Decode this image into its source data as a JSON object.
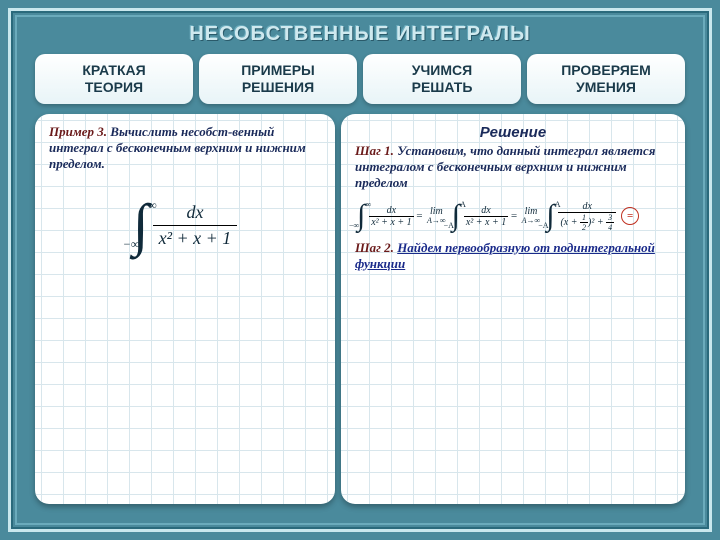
{
  "title": "НЕСОБСТВЕННЫЕ ИНТЕГРАЛЫ",
  "tabs": [
    {
      "line1": "КРАТКАЯ",
      "line2": "ТЕОРИЯ"
    },
    {
      "line1": "ПРИМЕРЫ",
      "line2": "РЕШЕНИЯ"
    },
    {
      "line1": "УЧИМСЯ",
      "line2": "РЕШАТЬ"
    },
    {
      "line1": "ПРОВЕРЯЕМ",
      "line2": "УМЕНИЯ"
    }
  ],
  "left": {
    "example_label": "Пример 3.",
    "task": "Вычислить несобст-венный интеграл с бесконечным верхним и нижним пределом.",
    "integral": {
      "upper": "∞",
      "lower": "−∞",
      "num": "dx",
      "den": "x² + x + 1"
    }
  },
  "right": {
    "solution_title": "Решение",
    "step1_label": "Шаг 1.",
    "step1_text": "Установим, что данный интеграл является интегралом с бесконечным верхним и нижним пределом",
    "step2_label": "Шаг 2.",
    "step2_link": "Найдем первообразную от подинтегральной функции",
    "eq": {
      "t1": {
        "up": "∞",
        "lo": "−∞",
        "num": "dx",
        "den": "x² + x + 1"
      },
      "eq1": "=",
      "lim1": {
        "top": "lim",
        "under": "A→∞"
      },
      "t2": {
        "up": "A",
        "lo": "−A",
        "num": "dx",
        "den": "x² + x + 1"
      },
      "eq2": "=",
      "lim2": {
        "top": "lim",
        "under": "A→∞"
      },
      "t3": {
        "up": "A",
        "lo": "−A",
        "num": "dx",
        "den_open": "(x + ",
        "den_half_n": "1",
        "den_half_d": "2",
        "den_close": ")² + ",
        "den_34_n": "3",
        "den_34_d": "4"
      },
      "circled": "="
    }
  }
}
